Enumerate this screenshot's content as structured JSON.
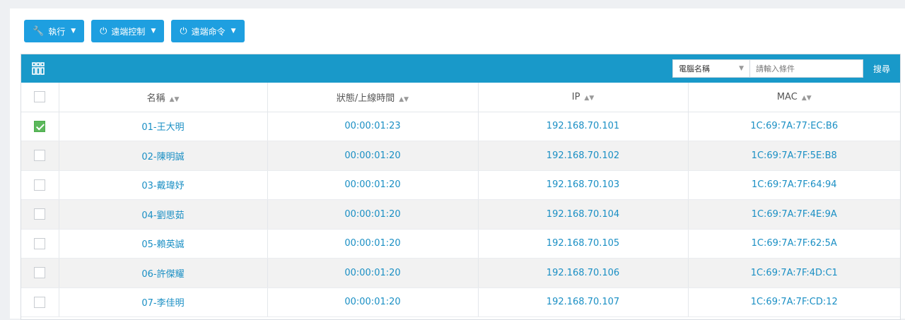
{
  "toolbar": {
    "buttons": [
      {
        "label": "執行",
        "icon": "wrench-icon"
      },
      {
        "label": "遠端控制",
        "icon": "power-icon"
      },
      {
        "label": "遠端命令",
        "icon": "power-icon"
      }
    ]
  },
  "panel": {
    "search": {
      "field_selected": "電腦名稱",
      "placeholder": "請輸入條件",
      "button_label": "搜尋"
    },
    "columns": [
      "名稱",
      "狀態/上線時間",
      "IP",
      "MAC"
    ],
    "rows": [
      {
        "checked": true,
        "name": "01-王大明",
        "status": "00:00:01:23",
        "ip": "192.168.70.101",
        "mac": "1C:69:7A:77:EC:B6"
      },
      {
        "checked": false,
        "name": "02-陳明誠",
        "status": "00:00:01:20",
        "ip": "192.168.70.102",
        "mac": "1C:69:7A:7F:5E:B8"
      },
      {
        "checked": false,
        "name": "03-戴瑋妤",
        "status": "00:00:01:20",
        "ip": "192.168.70.103",
        "mac": "1C:69:7A:7F:64:94"
      },
      {
        "checked": false,
        "name": "04-劉思茹",
        "status": "00:00:01:20",
        "ip": "192.168.70.104",
        "mac": "1C:69:7A:7F:4E:9A"
      },
      {
        "checked": false,
        "name": "05-賴英誠",
        "status": "00:00:01:20",
        "ip": "192.168.70.105",
        "mac": "1C:69:7A:7F:62:5A"
      },
      {
        "checked": false,
        "name": "06-許傑耀",
        "status": "00:00:01:20",
        "ip": "192.168.70.106",
        "mac": "1C:69:7A:7F:4D:C1"
      },
      {
        "checked": false,
        "name": "07-李佳明",
        "status": "00:00:01:20",
        "ip": "192.168.70.107",
        "mac": "1C:69:7A:7F:CD:12"
      }
    ]
  },
  "colors": {
    "toolbar_button": "#1e9fe0",
    "panel_header": "#1999c9",
    "link_text": "#1a8fc4",
    "checked": "#5cb85c"
  }
}
